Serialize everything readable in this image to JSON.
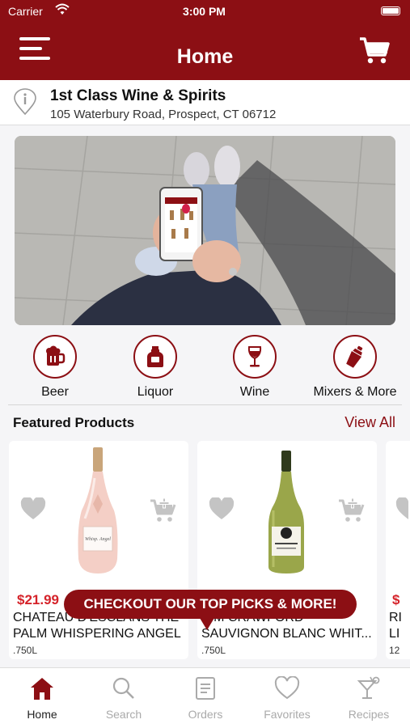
{
  "status_bar": {
    "carrier": "Carrier",
    "time": "3:00 PM"
  },
  "header": {
    "title": "Home",
    "menu_icon": "hamburger-menu-icon",
    "cart_icon": "shopping-cart-icon"
  },
  "store": {
    "name": "1st Class Wine & Spirits",
    "address": "105 Waterbury Road, Prospect, CT 06712"
  },
  "categories": [
    {
      "label": "Beer",
      "icon": "beer-mug-icon"
    },
    {
      "label": "Liquor",
      "icon": "liquor-bottle-icon"
    },
    {
      "label": "Wine",
      "icon": "wine-glass-icon"
    },
    {
      "label": "Mixers & More",
      "icon": "cocktail-shaker-icon"
    }
  ],
  "featured": {
    "title": "Featured Products",
    "view_all": "View All",
    "products": [
      {
        "price": "$21.99",
        "name_line1": "CHATEAU D'ESCLANS THE",
        "name_line2": "PALM WHISPERING ANGEL",
        "size": ".750L"
      },
      {
        "price": "",
        "name_line1": "KIM CRAWFORD",
        "name_line2": "SAUVIGNON BLANC WHIT...",
        "size": ".750L"
      },
      {
        "price": "$",
        "name_line1": "RI",
        "name_line2": "LI",
        "size": "12"
      }
    ]
  },
  "tooltip": "CHECKOUT OUR TOP PICKS & MORE!",
  "tabs": [
    {
      "label": "Home",
      "icon": "home-icon",
      "active": true
    },
    {
      "label": "Search",
      "icon": "search-icon"
    },
    {
      "label": "Orders",
      "icon": "orders-icon"
    },
    {
      "label": "Favorites",
      "icon": "heart-icon"
    },
    {
      "label": "Recipes",
      "icon": "cocktail-glass-icon"
    }
  ],
  "colors": {
    "brand": "#8c0f14",
    "price": "#d5232a"
  }
}
